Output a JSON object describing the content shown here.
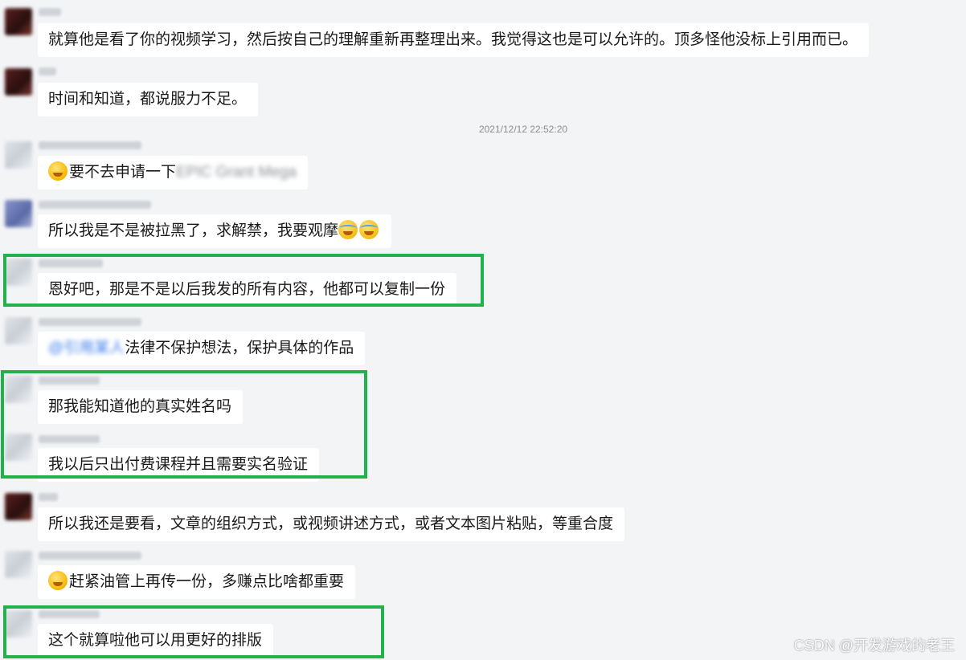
{
  "timestamp": "2021/12/12 22:52:20",
  "messages": [
    {
      "text": "就算他是看了你的视频学习，然后按自己的理解重新再整理出来。我觉得这也是可以允许的。顶多怪他没标上引用而已。"
    },
    {
      "text": "时间和知道，都说服力不足。"
    },
    {
      "text": "要不去申请一下",
      "blurred": "EPIC Grant Mega",
      "emoji": "thinking-face"
    },
    {
      "text": "所以我是不是被拉黑了，求解禁，我要观摩",
      "emoji": "tears-of-joy-face"
    },
    {
      "text": "恩好吧，那是不是以后我发的所有内容，他都可以复制一份"
    },
    {
      "text": "法律不保护想法，保护具体的作品",
      "blurred": "@引用某人"
    },
    {
      "text": "那我能知道他的真实姓名吗"
    },
    {
      "text": "我以后只出付费课程并且需要实名验证"
    },
    {
      "text": "所以我还是要看，文章的组织方式，或视频讲述方式，或者文本图片粘贴，等重合度"
    },
    {
      "text": "赶紧油管上再传一份，多赚点比啥都重要",
      "emoji": "thinking-face"
    },
    {
      "text": "这个就算啦他可以用更好的排版"
    }
  ],
  "watermark": "CSDN @开发游戏的老王",
  "colors": {
    "highlight": "#22b14c",
    "background": "#f3f4f6",
    "bubble": "#ffffff"
  }
}
